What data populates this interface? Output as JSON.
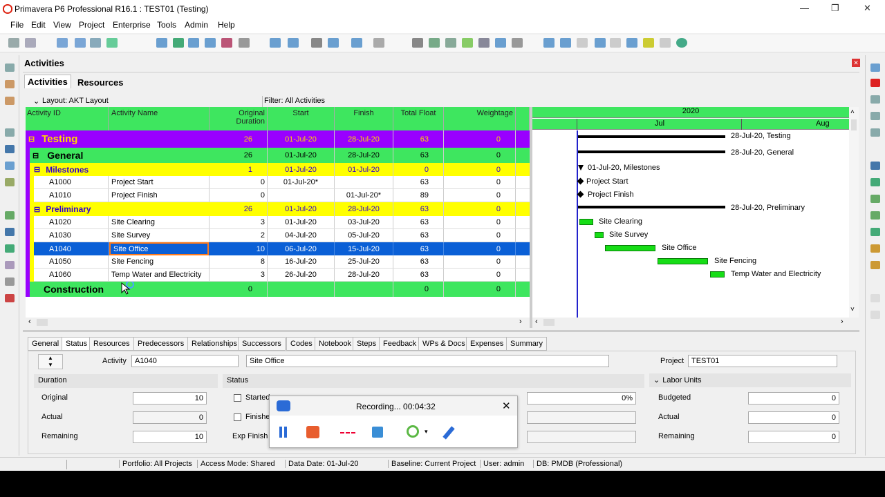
{
  "window": {
    "title": "Primavera P6 Professional R16.1 : TEST01 (Testing)"
  },
  "menu": [
    "File",
    "Edit",
    "View",
    "Project",
    "Enterprise",
    "Tools",
    "Admin",
    "Help"
  ],
  "panel": {
    "title": "Activities",
    "tabs": [
      "Activities",
      "Resources"
    ]
  },
  "layout": {
    "label": "Layout: AKT Layout",
    "filter": "Filter: All Activities"
  },
  "columns": {
    "id": "Activity ID",
    "name": "Activity Name",
    "duration": "Original\nDuration",
    "start": "Start",
    "finish": "Finish",
    "float": "Total Float",
    "weight": "Weightage"
  },
  "rows": [
    {
      "id": "",
      "name": "Testing",
      "dur": "26",
      "start": "01-Jul-20",
      "finish": "28-Jul-20",
      "float": "63",
      "weight": "0"
    },
    {
      "id": "",
      "name": "General",
      "dur": "26",
      "start": "01-Jul-20",
      "finish": "28-Jul-20",
      "float": "63",
      "weight": "0"
    },
    {
      "id": "",
      "name": "Milestones",
      "dur": "1",
      "start": "01-Jul-20",
      "finish": "01-Jul-20",
      "float": "0",
      "weight": "0"
    },
    {
      "id": "A1000",
      "name": "Project Start",
      "dur": "0",
      "start": "01-Jul-20*",
      "finish": "",
      "float": "63",
      "weight": "0"
    },
    {
      "id": "A1010",
      "name": "Project Finish",
      "dur": "0",
      "start": "",
      "finish": "01-Jul-20*",
      "float": "89",
      "weight": "0"
    },
    {
      "id": "",
      "name": "Preliminary",
      "dur": "26",
      "start": "01-Jul-20",
      "finish": "28-Jul-20",
      "float": "63",
      "weight": "0"
    },
    {
      "id": "A1020",
      "name": "Site Clearing",
      "dur": "3",
      "start": "01-Jul-20",
      "finish": "03-Jul-20",
      "float": "63",
      "weight": "0"
    },
    {
      "id": "A1030",
      "name": "Site Survey",
      "dur": "2",
      "start": "04-Jul-20",
      "finish": "05-Jul-20",
      "float": "63",
      "weight": "0"
    },
    {
      "id": "A1040",
      "name": "Site Office",
      "dur": "10",
      "start": "06-Jul-20",
      "finish": "15-Jul-20",
      "float": "63",
      "weight": "0"
    },
    {
      "id": "A1050",
      "name": "Site Fencing",
      "dur": "8",
      "start": "16-Jul-20",
      "finish": "25-Jul-20",
      "float": "63",
      "weight": "0"
    },
    {
      "id": "A1060",
      "name": "Temp Water and Electricity",
      "dur": "3",
      "start": "26-Jul-20",
      "finish": "28-Jul-20",
      "float": "63",
      "weight": "0"
    },
    {
      "id": "",
      "name": "Construction",
      "dur": "0",
      "start": "",
      "finish": "",
      "float": "0",
      "weight": "0"
    }
  ],
  "gantt": {
    "year": "2020",
    "months": [
      "Jul",
      "Aug"
    ],
    "labels": [
      "28-Jul-20, Testing",
      "28-Jul-20, General",
      "01-Jul-20, Milestones",
      "Project Start",
      "Project Finish",
      "28-Jul-20, Preliminary",
      "Site Clearing",
      "Site Survey",
      "Site Office",
      "Site Fencing",
      "Temp Water and Electricity"
    ]
  },
  "details": {
    "tabs": [
      "General",
      "Status",
      "Resources",
      "Predecessors",
      "Relationships",
      "Successors",
      "Codes",
      "Notebook",
      "Steps",
      "Feedback",
      "WPs & Docs",
      "Expenses",
      "Summary"
    ],
    "activity_label": "Activity",
    "activity_id": "A1040",
    "activity_name": "Site Office",
    "project_label": "Project",
    "project_value": "TEST01",
    "duration_title": "Duration",
    "status_title": "Status",
    "labor_title": "Labor Units",
    "original_label": "Original",
    "original_value": "10",
    "actual_label": "Actual",
    "actual_value": "0",
    "remaining_label": "Remaining",
    "remaining_value": "10",
    "started_label": "Started",
    "finished_label": "Finishe",
    "exp_finish_label": "Exp Finish",
    "pct_value": "0%",
    "budgeted_label": "Budgeted",
    "budgeted_value": "0",
    "labor_actual_label": "Actual",
    "labor_actual_value": "0",
    "labor_remaining_label": "Remaining",
    "labor_remaining_value": "0"
  },
  "recording": {
    "text": "Recording... 00:04:32"
  },
  "status": {
    "portfolio": "Portfolio: All Projects",
    "access": "Access Mode: Shared",
    "data_date": "Data Date: 01-Jul-20",
    "baseline": "Baseline: Current Project",
    "user": "User: admin",
    "db": "DB: PMDB (Professional)"
  }
}
